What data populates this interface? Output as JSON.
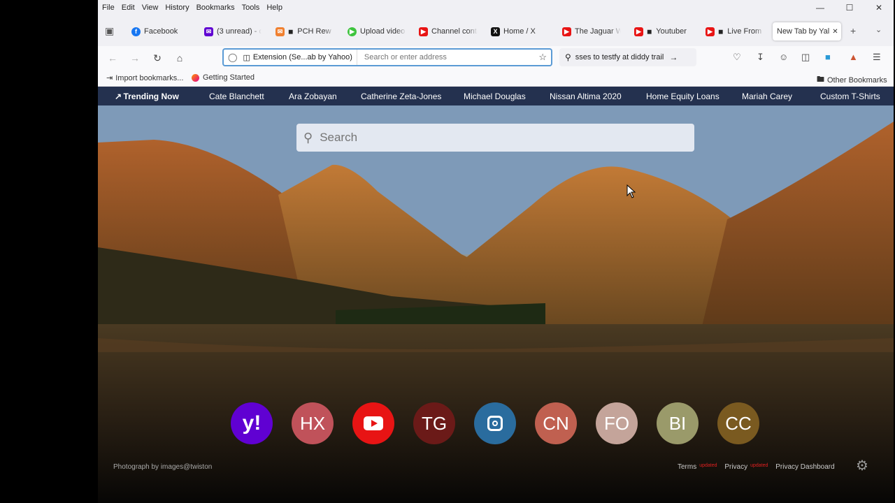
{
  "menu": [
    "File",
    "Edit",
    "View",
    "History",
    "Bookmarks",
    "Tools",
    "Help"
  ],
  "tabs": [
    {
      "label": "Facebook",
      "icon": "facebook-icon",
      "color": "#1877f2",
      "muted": false
    },
    {
      "label": "(3 unread) - c",
      "icon": "yahoo-mail-icon",
      "color": "#6001d2",
      "muted": false
    },
    {
      "label": "PCH Rew",
      "icon": "pch-icon",
      "color": "#f08030",
      "muted": true
    },
    {
      "label": "Upload video",
      "icon": "upload-icon",
      "color": "#3ec43e",
      "muted": false
    },
    {
      "label": "Channel conte",
      "icon": "youtube-icon",
      "color": "#e81414",
      "muted": false
    },
    {
      "label": "Home / X",
      "icon": "x-icon",
      "color": "#111111",
      "muted": false
    },
    {
      "label": "The Jaguar W",
      "icon": "youtube-icon",
      "color": "#e81414",
      "muted": false
    },
    {
      "label": "Youtuber",
      "icon": "youtube-icon",
      "color": "#e81414",
      "muted": true
    },
    {
      "label": "Live From",
      "icon": "youtube-icon",
      "color": "#e81414",
      "muted": true
    },
    {
      "label": "New Tab by Yal",
      "icon": "",
      "color": "",
      "muted": false,
      "active": true
    }
  ],
  "urlbar": {
    "extension_label": "Extension (Se...ab by Yahoo)",
    "placeholder": "Search or enter address"
  },
  "searchbar": {
    "value": "sses to testfy at diddy trail"
  },
  "bookmarks": {
    "import": "Import bookmarks...",
    "getting_started": "Getting Started",
    "other": "Other Bookmarks"
  },
  "trending": {
    "heading": "Trending Now",
    "items": [
      "Cate Blanchett",
      "Ara Zobayan",
      "Catherine Zeta-Jones",
      "Michael Douglas",
      "Nissan Altima 2020",
      "Home Equity Loans",
      "Mariah Carey",
      "Custom T-Shirts"
    ]
  },
  "search": {
    "placeholder": "Search"
  },
  "tiles": [
    {
      "label": "y!",
      "color": "#6001d2"
    },
    {
      "label": "HX",
      "color": "#c0525a"
    },
    {
      "label": "",
      "color": "#e81414",
      "icon": "youtube-play-icon"
    },
    {
      "label": "TG",
      "color": "#6b1a18"
    },
    {
      "label": "",
      "color": "#2a6c9e",
      "icon": "instagram-icon"
    },
    {
      "label": "CN",
      "color": "#c06050"
    },
    {
      "label": "FO",
      "color": "#c4a49a"
    },
    {
      "label": "BI",
      "color": "#9a9a6a"
    },
    {
      "label": "CC",
      "color": "#7a5a20"
    }
  ],
  "footer": {
    "credit": "Photograph by images@twiston",
    "terms": "Terms",
    "terms_badge": "updated",
    "privacy": "Privacy",
    "privacy_badge": "updated",
    "dashboard": "Privacy Dashboard"
  }
}
